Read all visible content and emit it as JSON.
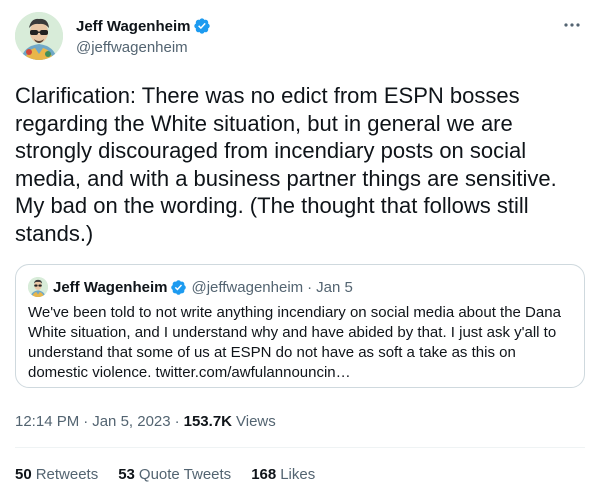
{
  "author": {
    "display_name": "Jeff Wagenheim",
    "handle": "@jeffwagenheim",
    "verified": true
  },
  "tweet": {
    "text": "Clarification: There was no edict from ESPN bosses regarding the White situation, but in general we are strongly discouraged from incendiary posts on social media, and with a business partner things are sensitive. My bad on the wording. (The thought that follows still stands.)"
  },
  "quoted_tweet": {
    "display_name": "Jeff Wagenheim",
    "handle": "@jeffwagenheim",
    "separator": "·",
    "date": "Jan 5",
    "text": "We've been told to not write anything incendiary on social media about the Dana White situation, and I understand why and have abided by that. I just ask y'all to understand that some of us at ESPN do not have as soft a take as this on domestic violence. twitter.com/awfulannouncin…"
  },
  "meta": {
    "time": "12:14 PM",
    "separator": "·",
    "date": "Jan 5, 2023",
    "views_count": "153.7K",
    "views_label": "Views"
  },
  "stats": {
    "retweets_count": "50",
    "retweets_label": "Retweets",
    "quote_tweets_count": "53",
    "quote_tweets_label": "Quote Tweets",
    "likes_count": "168",
    "likes_label": "Likes"
  },
  "icons": {
    "verified": "verified-badge-icon",
    "more": "more-options-icon"
  },
  "colors": {
    "verified_blue": "#1d9bf0",
    "text_primary": "#0f1419",
    "text_secondary": "#536471",
    "border": "#cfd9de"
  }
}
